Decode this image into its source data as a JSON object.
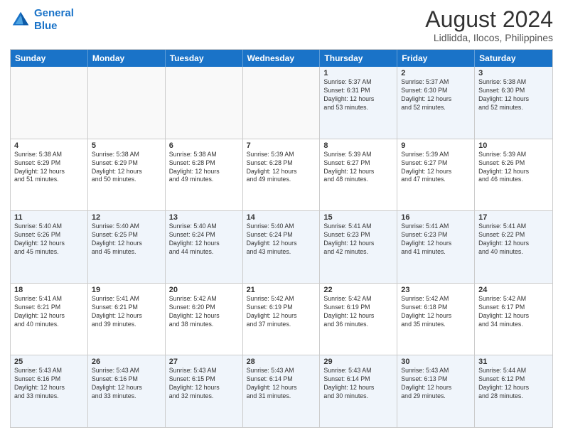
{
  "header": {
    "logo_line1": "General",
    "logo_line2": "Blue",
    "month_year": "August 2024",
    "location": "Lidlidda, Ilocos, Philippines"
  },
  "weekdays": [
    "Sunday",
    "Monday",
    "Tuesday",
    "Wednesday",
    "Thursday",
    "Friday",
    "Saturday"
  ],
  "rows": [
    [
      {
        "day": "",
        "text": ""
      },
      {
        "day": "",
        "text": ""
      },
      {
        "day": "",
        "text": ""
      },
      {
        "day": "",
        "text": ""
      },
      {
        "day": "1",
        "text": "Sunrise: 5:37 AM\nSunset: 6:31 PM\nDaylight: 12 hours\nand 53 minutes."
      },
      {
        "day": "2",
        "text": "Sunrise: 5:37 AM\nSunset: 6:30 PM\nDaylight: 12 hours\nand 52 minutes."
      },
      {
        "day": "3",
        "text": "Sunrise: 5:38 AM\nSunset: 6:30 PM\nDaylight: 12 hours\nand 52 minutes."
      }
    ],
    [
      {
        "day": "4",
        "text": "Sunrise: 5:38 AM\nSunset: 6:29 PM\nDaylight: 12 hours\nand 51 minutes."
      },
      {
        "day": "5",
        "text": "Sunrise: 5:38 AM\nSunset: 6:29 PM\nDaylight: 12 hours\nand 50 minutes."
      },
      {
        "day": "6",
        "text": "Sunrise: 5:38 AM\nSunset: 6:28 PM\nDaylight: 12 hours\nand 49 minutes."
      },
      {
        "day": "7",
        "text": "Sunrise: 5:39 AM\nSunset: 6:28 PM\nDaylight: 12 hours\nand 49 minutes."
      },
      {
        "day": "8",
        "text": "Sunrise: 5:39 AM\nSunset: 6:27 PM\nDaylight: 12 hours\nand 48 minutes."
      },
      {
        "day": "9",
        "text": "Sunrise: 5:39 AM\nSunset: 6:27 PM\nDaylight: 12 hours\nand 47 minutes."
      },
      {
        "day": "10",
        "text": "Sunrise: 5:39 AM\nSunset: 6:26 PM\nDaylight: 12 hours\nand 46 minutes."
      }
    ],
    [
      {
        "day": "11",
        "text": "Sunrise: 5:40 AM\nSunset: 6:26 PM\nDaylight: 12 hours\nand 45 minutes."
      },
      {
        "day": "12",
        "text": "Sunrise: 5:40 AM\nSunset: 6:25 PM\nDaylight: 12 hours\nand 45 minutes."
      },
      {
        "day": "13",
        "text": "Sunrise: 5:40 AM\nSunset: 6:24 PM\nDaylight: 12 hours\nand 44 minutes."
      },
      {
        "day": "14",
        "text": "Sunrise: 5:40 AM\nSunset: 6:24 PM\nDaylight: 12 hours\nand 43 minutes."
      },
      {
        "day": "15",
        "text": "Sunrise: 5:41 AM\nSunset: 6:23 PM\nDaylight: 12 hours\nand 42 minutes."
      },
      {
        "day": "16",
        "text": "Sunrise: 5:41 AM\nSunset: 6:23 PM\nDaylight: 12 hours\nand 41 minutes."
      },
      {
        "day": "17",
        "text": "Sunrise: 5:41 AM\nSunset: 6:22 PM\nDaylight: 12 hours\nand 40 minutes."
      }
    ],
    [
      {
        "day": "18",
        "text": "Sunrise: 5:41 AM\nSunset: 6:21 PM\nDaylight: 12 hours\nand 40 minutes."
      },
      {
        "day": "19",
        "text": "Sunrise: 5:41 AM\nSunset: 6:21 PM\nDaylight: 12 hours\nand 39 minutes."
      },
      {
        "day": "20",
        "text": "Sunrise: 5:42 AM\nSunset: 6:20 PM\nDaylight: 12 hours\nand 38 minutes."
      },
      {
        "day": "21",
        "text": "Sunrise: 5:42 AM\nSunset: 6:19 PM\nDaylight: 12 hours\nand 37 minutes."
      },
      {
        "day": "22",
        "text": "Sunrise: 5:42 AM\nSunset: 6:19 PM\nDaylight: 12 hours\nand 36 minutes."
      },
      {
        "day": "23",
        "text": "Sunrise: 5:42 AM\nSunset: 6:18 PM\nDaylight: 12 hours\nand 35 minutes."
      },
      {
        "day": "24",
        "text": "Sunrise: 5:42 AM\nSunset: 6:17 PM\nDaylight: 12 hours\nand 34 minutes."
      }
    ],
    [
      {
        "day": "25",
        "text": "Sunrise: 5:43 AM\nSunset: 6:16 PM\nDaylight: 12 hours\nand 33 minutes."
      },
      {
        "day": "26",
        "text": "Sunrise: 5:43 AM\nSunset: 6:16 PM\nDaylight: 12 hours\nand 33 minutes."
      },
      {
        "day": "27",
        "text": "Sunrise: 5:43 AM\nSunset: 6:15 PM\nDaylight: 12 hours\nand 32 minutes."
      },
      {
        "day": "28",
        "text": "Sunrise: 5:43 AM\nSunset: 6:14 PM\nDaylight: 12 hours\nand 31 minutes."
      },
      {
        "day": "29",
        "text": "Sunrise: 5:43 AM\nSunset: 6:14 PM\nDaylight: 12 hours\nand 30 minutes."
      },
      {
        "day": "30",
        "text": "Sunrise: 5:43 AM\nSunset: 6:13 PM\nDaylight: 12 hours\nand 29 minutes."
      },
      {
        "day": "31",
        "text": "Sunrise: 5:44 AM\nSunset: 6:12 PM\nDaylight: 12 hours\nand 28 minutes."
      }
    ]
  ]
}
